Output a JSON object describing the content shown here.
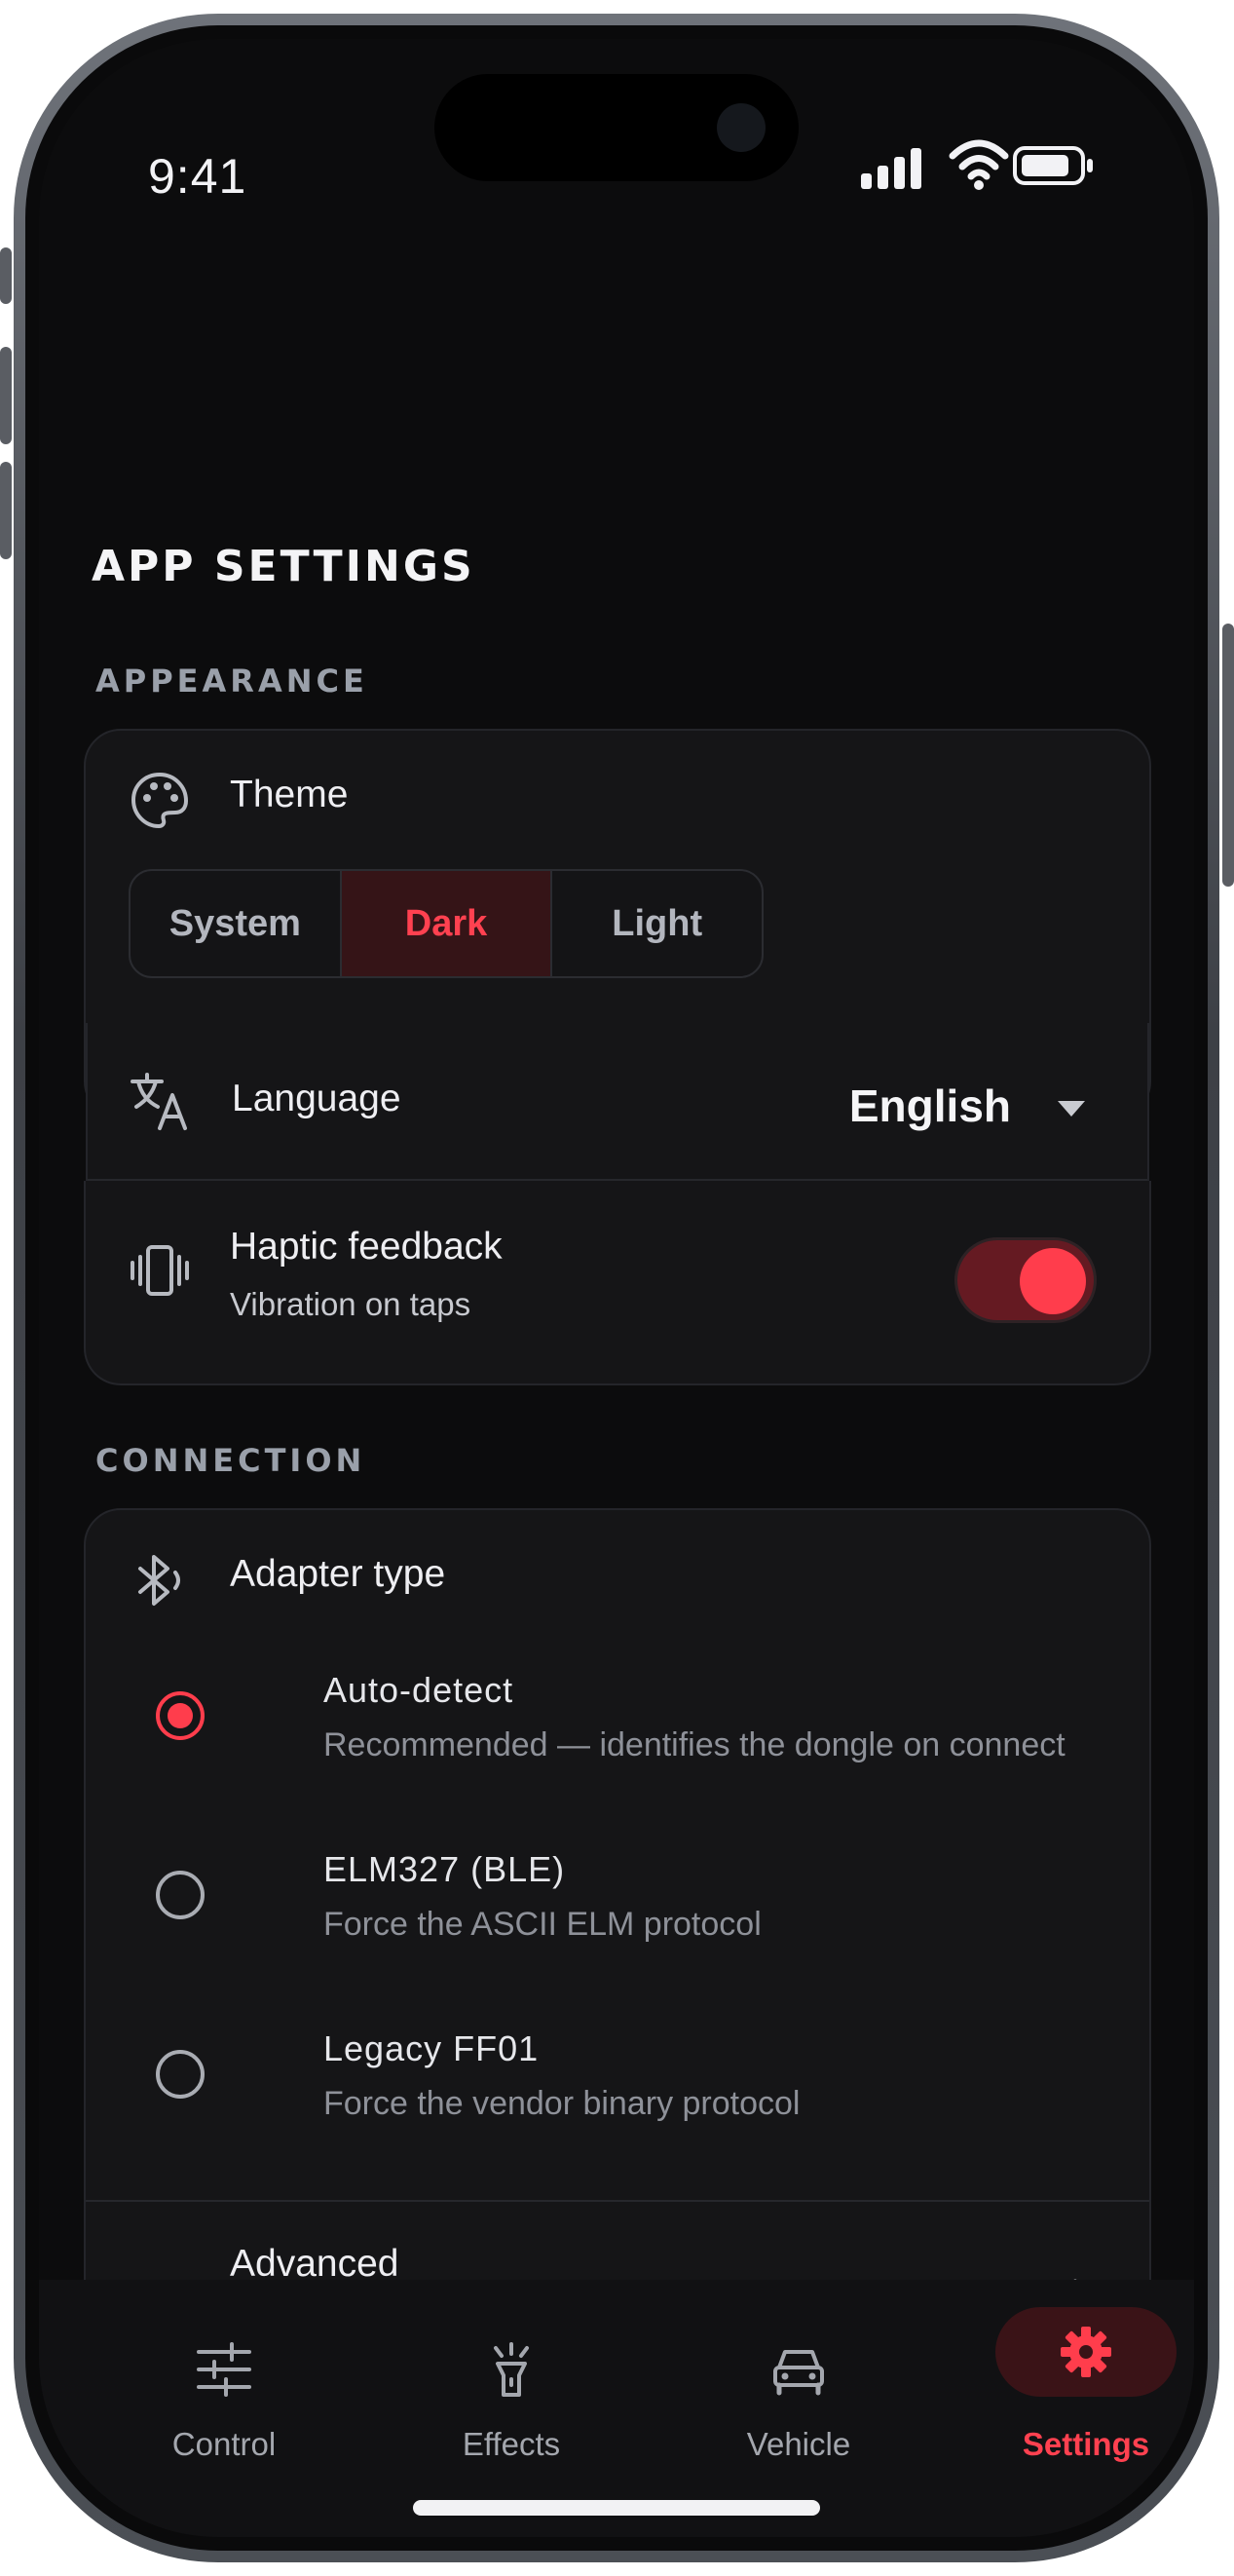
{
  "status_bar": {
    "time": "9:41"
  },
  "page": {
    "title": "APP SETTINGS"
  },
  "appearance": {
    "section_label": "APPEARANCE",
    "theme": {
      "label": "Theme",
      "icon": "palette-icon",
      "options": [
        "System",
        "Dark",
        "Light"
      ],
      "selected": "Dark"
    },
    "language": {
      "label": "Language",
      "icon": "translate-icon",
      "value": "English"
    },
    "haptic": {
      "label": "Haptic feedback",
      "sublabel": "Vibration on taps",
      "icon": "vibration-icon",
      "enabled": true
    }
  },
  "connection": {
    "section_label": "CONNECTION",
    "adapter": {
      "label": "Adapter type",
      "icon": "bluetooth-icon",
      "selected": "Auto-detect",
      "options": [
        {
          "label": "Auto-detect",
          "sublabel": "Recommended — identifies the dongle on connect"
        },
        {
          "label": "ELM327 (BLE)",
          "sublabel": "Force the ASCII ELM protocol"
        },
        {
          "label": "Legacy FF01",
          "sublabel": "Force the vendor binary protocol"
        }
      ]
    },
    "advanced": {
      "label": "Advanced",
      "icon": "sliders-icon"
    }
  },
  "tabbar": {
    "active": "Settings",
    "items": [
      {
        "label": "Control",
        "icon": "sliders-icon"
      },
      {
        "label": "Effects",
        "icon": "flashlight-icon"
      },
      {
        "label": "Vehicle",
        "icon": "car-icon"
      },
      {
        "label": "Settings",
        "icon": "gear-icon"
      }
    ]
  },
  "colors": {
    "accent": "#ff3d4c",
    "background": "#0c0c0d",
    "card": "#151517",
    "muted_text": "#8e9199"
  }
}
